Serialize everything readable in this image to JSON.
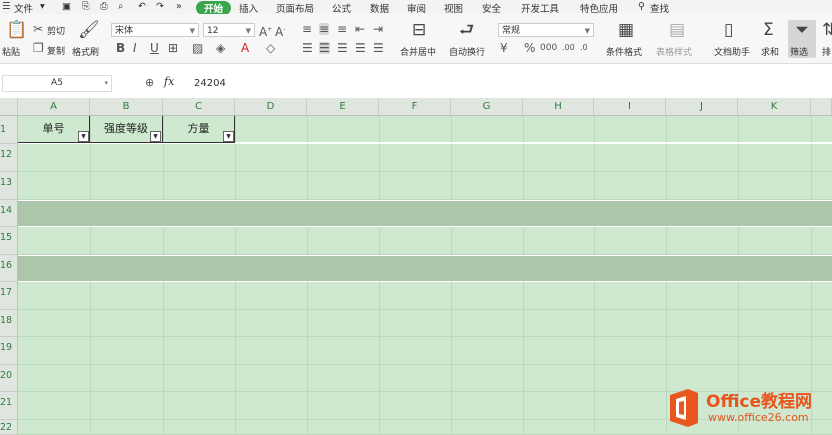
{
  "menu": {
    "file": "文件",
    "tabs": [
      "开始",
      "插入",
      "页面布局",
      "公式",
      "数据",
      "审阅",
      "视图",
      "安全",
      "开发工具",
      "特色应用"
    ],
    "active_tab": "开始",
    "search": "查找"
  },
  "ribbon": {
    "paste": "粘贴",
    "cut": "剪切",
    "copy": "复制",
    "format_painter": "格式刷",
    "font_name": "宋体",
    "font_size": "12",
    "merge_center": "合并居中",
    "wrap_text": "自动换行",
    "number_format": "常规",
    "conditional_format": "条件格式",
    "table_style": "表格样式",
    "doc_assistant": "文档助手",
    "sum": "求和",
    "filter": "筛选",
    "sort": "排"
  },
  "formula_bar": {
    "cell_ref": "A5",
    "fx": "fx",
    "value": "24204"
  },
  "sheet": {
    "columns": [
      "A",
      "B",
      "C",
      "D",
      "E",
      "F",
      "G",
      "H",
      "I",
      "J",
      "K"
    ],
    "rows": [
      "1",
      "12",
      "13",
      "14",
      "15",
      "16",
      "17",
      "18",
      "19",
      "20",
      "21",
      "22"
    ],
    "selected_rows": [
      "14",
      "16"
    ],
    "headers": [
      "单号",
      "强度等级",
      "方量"
    ]
  },
  "watermark": {
    "brand": "Office教程网",
    "url": "www.office26.com"
  },
  "colors": {
    "accent": "#3aa54d",
    "sheet_bg": "#cfe8d0",
    "selected_row": "#abc6ab",
    "logo_orange": "#e8551d"
  }
}
